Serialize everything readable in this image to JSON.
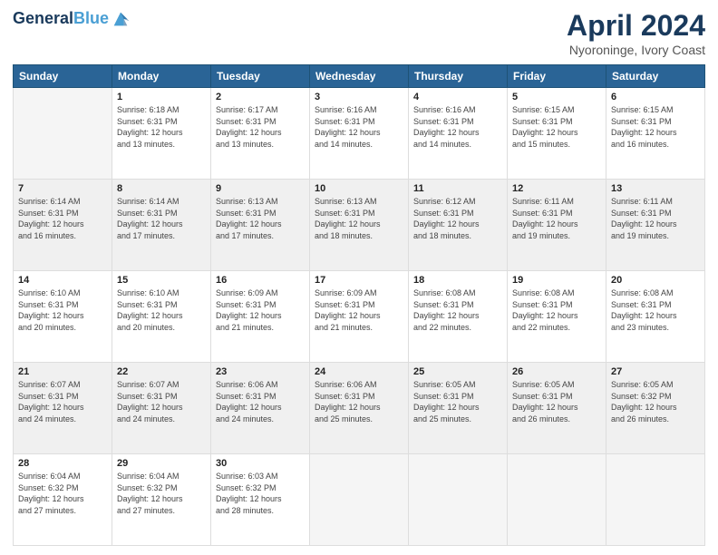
{
  "header": {
    "logo_line1": "General",
    "logo_line2": "Blue",
    "month_title": "April 2024",
    "location": "Nyoroninge, Ivory Coast"
  },
  "days_of_week": [
    "Sunday",
    "Monday",
    "Tuesday",
    "Wednesday",
    "Thursday",
    "Friday",
    "Saturday"
  ],
  "weeks": [
    [
      {
        "num": "",
        "empty": true
      },
      {
        "num": "1",
        "rise": "6:18 AM",
        "set": "6:31 PM",
        "hours": "12 hours",
        "mins": "and 13 minutes."
      },
      {
        "num": "2",
        "rise": "6:17 AM",
        "set": "6:31 PM",
        "hours": "12 hours",
        "mins": "and 13 minutes."
      },
      {
        "num": "3",
        "rise": "6:16 AM",
        "set": "6:31 PM",
        "hours": "12 hours",
        "mins": "and 14 minutes."
      },
      {
        "num": "4",
        "rise": "6:16 AM",
        "set": "6:31 PM",
        "hours": "12 hours",
        "mins": "and 14 minutes."
      },
      {
        "num": "5",
        "rise": "6:15 AM",
        "set": "6:31 PM",
        "hours": "12 hours",
        "mins": "and 15 minutes."
      },
      {
        "num": "6",
        "rise": "6:15 AM",
        "set": "6:31 PM",
        "hours": "12 hours",
        "mins": "and 16 minutes."
      }
    ],
    [
      {
        "num": "7",
        "rise": "6:14 AM",
        "set": "6:31 PM",
        "hours": "12 hours",
        "mins": "and 16 minutes."
      },
      {
        "num": "8",
        "rise": "6:14 AM",
        "set": "6:31 PM",
        "hours": "12 hours",
        "mins": "and 17 minutes."
      },
      {
        "num": "9",
        "rise": "6:13 AM",
        "set": "6:31 PM",
        "hours": "12 hours",
        "mins": "and 17 minutes."
      },
      {
        "num": "10",
        "rise": "6:13 AM",
        "set": "6:31 PM",
        "hours": "12 hours",
        "mins": "and 18 minutes."
      },
      {
        "num": "11",
        "rise": "6:12 AM",
        "set": "6:31 PM",
        "hours": "12 hours",
        "mins": "and 18 minutes."
      },
      {
        "num": "12",
        "rise": "6:11 AM",
        "set": "6:31 PM",
        "hours": "12 hours",
        "mins": "and 19 minutes."
      },
      {
        "num": "13",
        "rise": "6:11 AM",
        "set": "6:31 PM",
        "hours": "12 hours",
        "mins": "and 19 minutes."
      }
    ],
    [
      {
        "num": "14",
        "rise": "6:10 AM",
        "set": "6:31 PM",
        "hours": "12 hours",
        "mins": "and 20 minutes."
      },
      {
        "num": "15",
        "rise": "6:10 AM",
        "set": "6:31 PM",
        "hours": "12 hours",
        "mins": "and 20 minutes."
      },
      {
        "num": "16",
        "rise": "6:09 AM",
        "set": "6:31 PM",
        "hours": "12 hours",
        "mins": "and 21 minutes."
      },
      {
        "num": "17",
        "rise": "6:09 AM",
        "set": "6:31 PM",
        "hours": "12 hours",
        "mins": "and 21 minutes."
      },
      {
        "num": "18",
        "rise": "6:08 AM",
        "set": "6:31 PM",
        "hours": "12 hours",
        "mins": "and 22 minutes."
      },
      {
        "num": "19",
        "rise": "6:08 AM",
        "set": "6:31 PM",
        "hours": "12 hours",
        "mins": "and 22 minutes."
      },
      {
        "num": "20",
        "rise": "6:08 AM",
        "set": "6:31 PM",
        "hours": "12 hours",
        "mins": "and 23 minutes."
      }
    ],
    [
      {
        "num": "21",
        "rise": "6:07 AM",
        "set": "6:31 PM",
        "hours": "12 hours",
        "mins": "and 24 minutes."
      },
      {
        "num": "22",
        "rise": "6:07 AM",
        "set": "6:31 PM",
        "hours": "12 hours",
        "mins": "and 24 minutes."
      },
      {
        "num": "23",
        "rise": "6:06 AM",
        "set": "6:31 PM",
        "hours": "12 hours",
        "mins": "and 24 minutes."
      },
      {
        "num": "24",
        "rise": "6:06 AM",
        "set": "6:31 PM",
        "hours": "12 hours",
        "mins": "and 25 minutes."
      },
      {
        "num": "25",
        "rise": "6:05 AM",
        "set": "6:31 PM",
        "hours": "12 hours",
        "mins": "and 25 minutes."
      },
      {
        "num": "26",
        "rise": "6:05 AM",
        "set": "6:31 PM",
        "hours": "12 hours",
        "mins": "and 26 minutes."
      },
      {
        "num": "27",
        "rise": "6:05 AM",
        "set": "6:32 PM",
        "hours": "12 hours",
        "mins": "and 26 minutes."
      }
    ],
    [
      {
        "num": "28",
        "rise": "6:04 AM",
        "set": "6:32 PM",
        "hours": "12 hours",
        "mins": "and 27 minutes."
      },
      {
        "num": "29",
        "rise": "6:04 AM",
        "set": "6:32 PM",
        "hours": "12 hours",
        "mins": "and 27 minutes."
      },
      {
        "num": "30",
        "rise": "6:03 AM",
        "set": "6:32 PM",
        "hours": "12 hours",
        "mins": "and 28 minutes."
      },
      {
        "num": "",
        "empty": true
      },
      {
        "num": "",
        "empty": true
      },
      {
        "num": "",
        "empty": true
      },
      {
        "num": "",
        "empty": true
      }
    ]
  ],
  "labels": {
    "sunrise": "Sunrise:",
    "sunset": "Sunset:",
    "daylight": "Daylight:"
  }
}
